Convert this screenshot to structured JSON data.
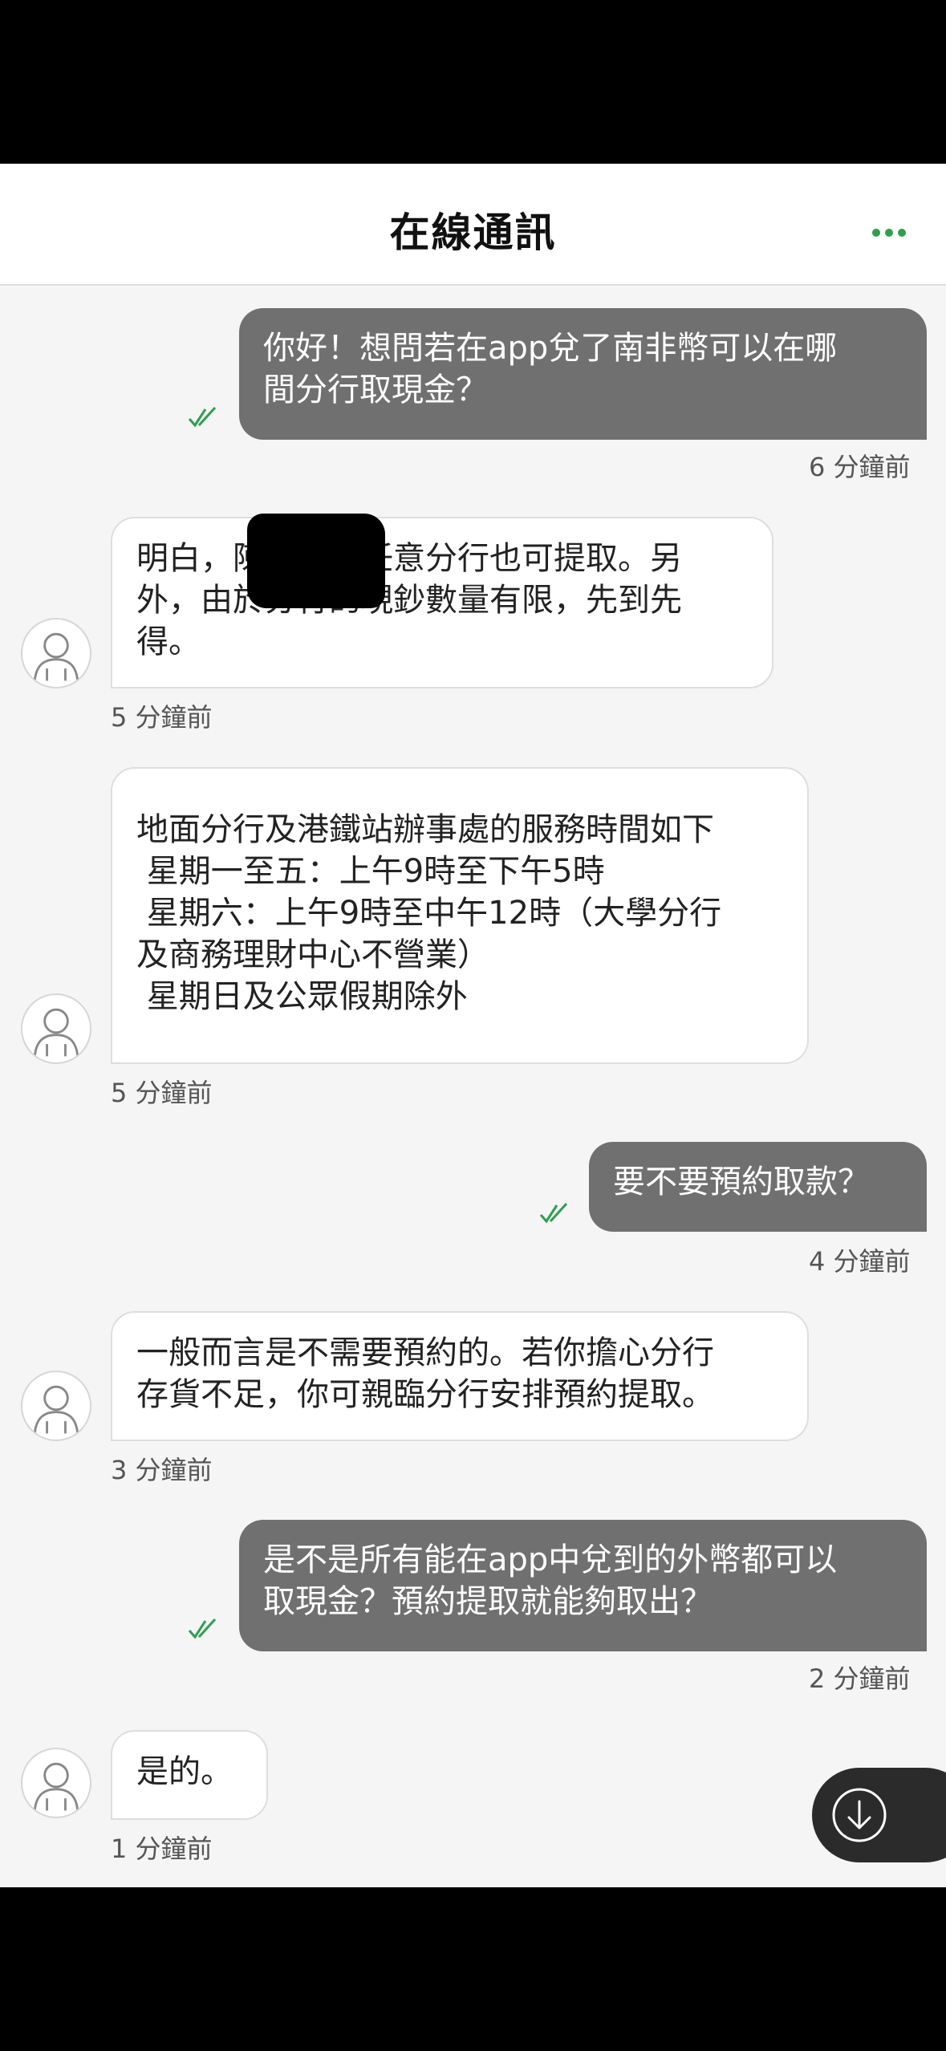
{
  "header": {
    "title": "在線通訊"
  },
  "messages": [
    {
      "dir": "out",
      "text": "你好！想問若在app兌了南非幣可以在哪\n間分行取現金？",
      "time": "6 分鐘前"
    },
    {
      "dir": "in",
      "text": "明白，陳先生，任意分行也可提取。另\n外，由於分行的現鈔數量有限，先到先\n得。",
      "time": "5 分鐘前"
    },
    {
      "dir": "in",
      "text": "地面分行及港鐵站辦事處的服務時間如下\n 星期一至五：上午9時至下午5時\n 星期六：上午9時至中午12時（大學分行\n及商務理財中心不營業）\n 星期日及公眾假期除外",
      "time": "5 分鐘前"
    },
    {
      "dir": "out",
      "text": "要不要預約取款？",
      "time": "4 分鐘前"
    },
    {
      "dir": "in",
      "text": "一般而言是不需要預約的。若你擔心分行\n存貨不足，你可親臨分行安排預約提取。",
      "time": "3 分鐘前"
    },
    {
      "dir": "out",
      "text": "是不是所有能在app中兌到的外幣都可以\n取現金？預約提取就能夠取出？",
      "time": "2 分鐘前"
    },
    {
      "dir": "in",
      "text": "是的。",
      "time": "1 分鐘前"
    }
  ],
  "colors": {
    "accent": "#2e9e4f",
    "outgoing_bubble": "#707070",
    "incoming_bubble": "#ffffff",
    "chat_background": "#f5f5f5"
  },
  "icons": {
    "close": "close-icon",
    "more": "more-dots-icon",
    "read_receipt": "double-check-icon",
    "avatar": "user-avatar-icon",
    "scroll_down": "arrow-down-circle-icon"
  }
}
